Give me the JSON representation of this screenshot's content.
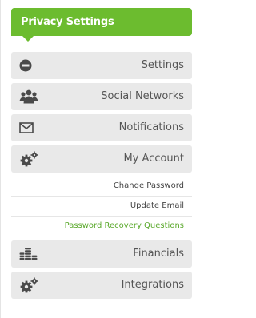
{
  "header": {
    "title": "Privacy Settings"
  },
  "menu": [
    {
      "label": "Settings",
      "icon": "no-entry-icon"
    },
    {
      "label": "Social Networks",
      "icon": "users-icon"
    },
    {
      "label": "Notifications",
      "icon": "envelope-icon"
    },
    {
      "label": "My Account",
      "icon": "gears-icon"
    }
  ],
  "submenu": [
    {
      "label": "Change Password",
      "active": false
    },
    {
      "label": "Update Email",
      "active": false
    },
    {
      "label": "Password Recovery Questions",
      "active": true
    }
  ],
  "menu_after": [
    {
      "label": "Financials",
      "icon": "coins-icon"
    },
    {
      "label": "Integrations",
      "icon": "gears-icon"
    }
  ],
  "colors": {
    "accent": "#6cbc2f",
    "active_link": "#59a82a",
    "item_bg": "#e9e9e9",
    "icon": "#4a4a4a"
  }
}
